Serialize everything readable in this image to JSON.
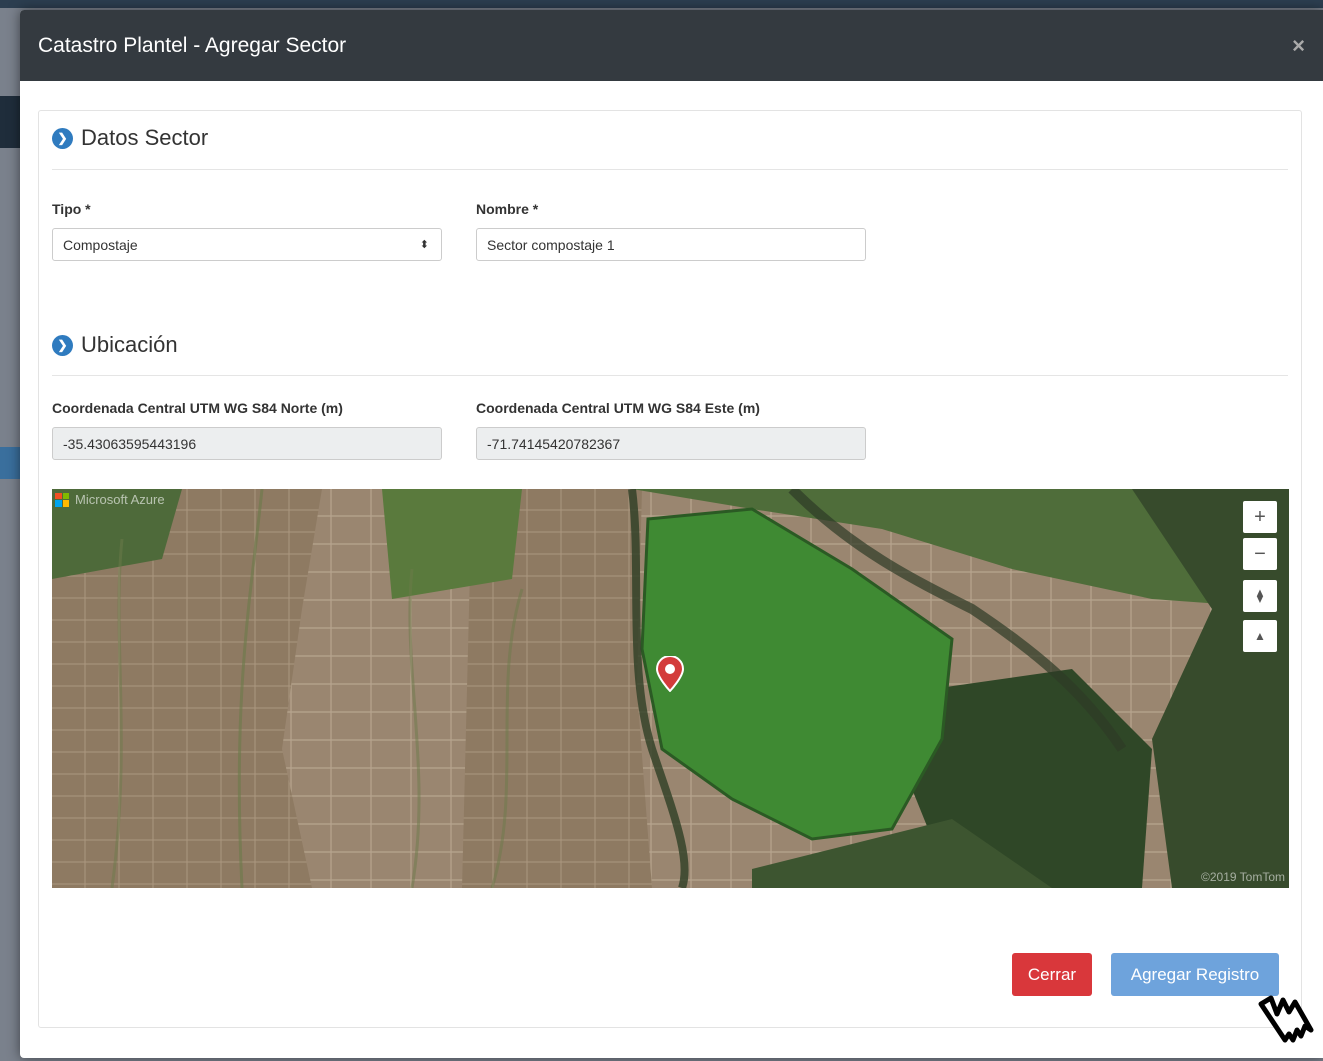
{
  "modal": {
    "title": "Catastro Plantel - Agregar Sector",
    "close_symbol": "×"
  },
  "sections": {
    "datos": {
      "title": "Datos Sector",
      "icon": "chevron-circle-right-icon"
    },
    "ubicacion": {
      "title": "Ubicación",
      "icon": "chevron-circle-right-icon"
    }
  },
  "form": {
    "tipo": {
      "label": "Tipo *",
      "value": "Compostaje"
    },
    "nombre": {
      "label": "Nombre *",
      "value": "Sector compostaje 1"
    },
    "norte": {
      "label": "Coordenada Central UTM WG S84 Norte (m)",
      "value": "-35.43063595443196"
    },
    "este": {
      "label": "Coordenada Central UTM WG S84 Este (m)",
      "value": "-71.74145420782367"
    }
  },
  "map": {
    "provider": "Microsoft Azure",
    "attribution": "©2019 TomTom",
    "controls": {
      "zoom_in": "+",
      "zoom_out": "−",
      "compass": "⧫",
      "pitch": "▲"
    }
  },
  "buttons": {
    "cancel": "Cerrar",
    "submit": "Agregar Registro"
  },
  "colors": {
    "header": "#343a40",
    "accent": "#2f7bbf",
    "danger": "#d9373b",
    "primary": "#6ea3dc"
  }
}
